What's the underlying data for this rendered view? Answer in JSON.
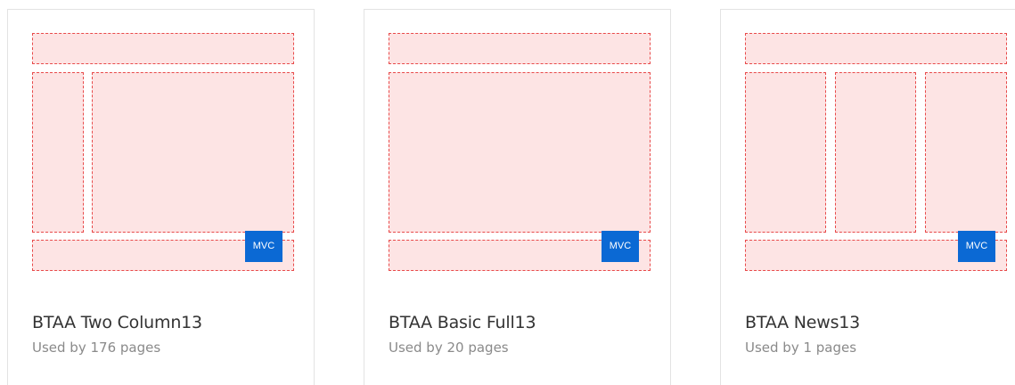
{
  "templates": [
    {
      "title": "BTAA Two Column13",
      "usage": "Used by 176 pages",
      "badge": "MVC",
      "layout": "two-column"
    },
    {
      "title": "BTAA Basic Full13",
      "usage": "Used by 20 pages",
      "badge": "MVC",
      "layout": "basic-full"
    },
    {
      "title": "BTAA News13",
      "usage": "Used by 1 pages",
      "badge": "MVC",
      "layout": "news-three-column"
    }
  ],
  "colors": {
    "placeholder_fill": "#fde4e4",
    "placeholder_border": "#e84a4a",
    "badge_bg": "#0b69d4",
    "title_text": "#333333",
    "meta_text": "#8a8a8a",
    "card_border": "#e3e3e3"
  }
}
